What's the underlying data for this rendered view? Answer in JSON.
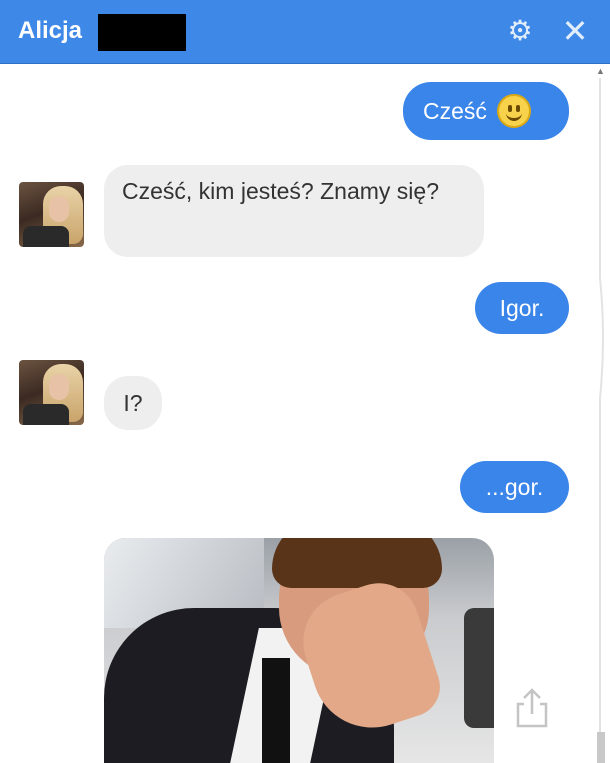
{
  "header": {
    "title": "Alicja",
    "settings_icon": "gear-icon",
    "close_icon": "close-icon",
    "background_color": "#3e88e8"
  },
  "messages": [
    {
      "side": "outgoing",
      "text": "Cześć",
      "has_emoji": true
    },
    {
      "side": "incoming",
      "text": "Cześć, kim jesteś? Znamy się?"
    },
    {
      "side": "outgoing",
      "text": "Igor."
    },
    {
      "side": "incoming",
      "text": "I?"
    },
    {
      "side": "outgoing",
      "text": "...gor."
    },
    {
      "side": "outgoing",
      "type": "image",
      "description": "photo"
    }
  ],
  "colors": {
    "outgoing_bubble": "#3a85ea",
    "incoming_bubble": "#eeeeee"
  },
  "share_icon": "share-icon"
}
